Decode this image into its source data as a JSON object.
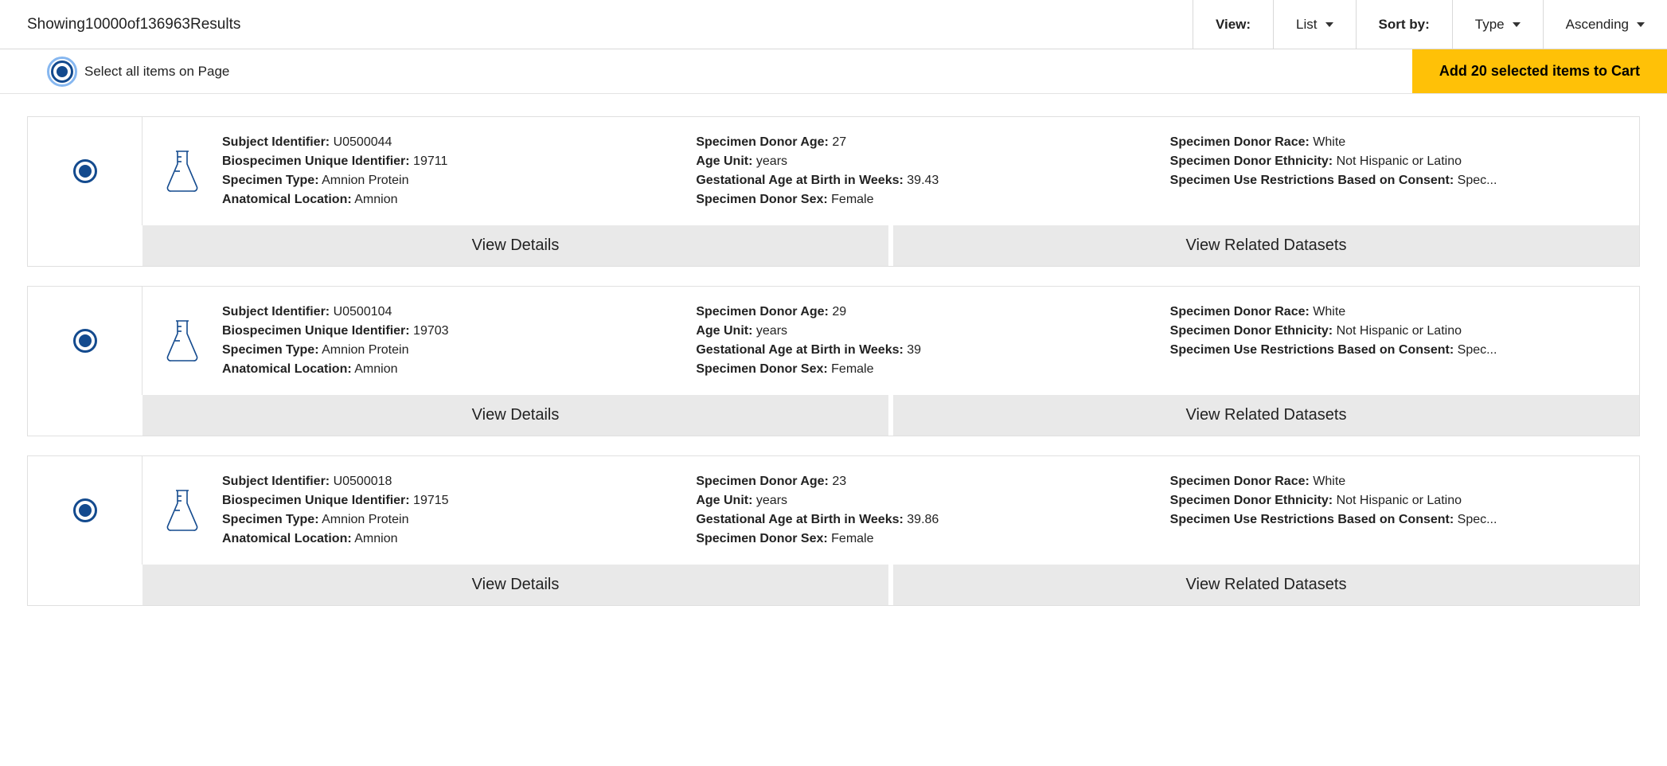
{
  "header": {
    "results_text_prefix": "Showing ",
    "shown": "10000",
    "of_word": " of ",
    "total": "136963",
    "results_word": " Results",
    "view_label": "View:",
    "view_value": "List",
    "sort_label": "Sort by:",
    "sort_value": "Type",
    "order_value": "Ascending"
  },
  "select_all_label": "Select all items on Page",
  "cart_button": "Add 20 selected items to Cart",
  "labels": {
    "subject_id": "Subject Identifier:",
    "biospecimen_id": "Biospecimen Unique Identifier:",
    "specimen_type": "Specimen Type:",
    "anatomical_location": "Anatomical Location:",
    "donor_age": "Specimen Donor Age:",
    "age_unit": "Age Unit:",
    "gestational_age": "Gestational Age at Birth in Weeks:",
    "donor_sex": "Specimen Donor Sex:",
    "donor_race": "Specimen Donor Race:",
    "donor_ethnicity": "Specimen Donor Ethnicity:",
    "use_restrictions": "Specimen Use Restrictions Based on Consent:",
    "view_details": "View Details",
    "view_related": "View Related Datasets"
  },
  "items": [
    {
      "subject_id": "U0500044",
      "biospecimen_id": "19711",
      "specimen_type": "Amnion Protein",
      "anatomical_location": "Amnion",
      "donor_age": "27",
      "age_unit": "years",
      "gestational_age": "39.43",
      "donor_sex": "Female",
      "donor_race": "White",
      "donor_ethnicity": "Not Hispanic or Latino",
      "use_restrictions": "Spec..."
    },
    {
      "subject_id": "U0500104",
      "biospecimen_id": "19703",
      "specimen_type": "Amnion Protein",
      "anatomical_location": "Amnion",
      "donor_age": "29",
      "age_unit": "years",
      "gestational_age": "39",
      "donor_sex": "Female",
      "donor_race": "White",
      "donor_ethnicity": "Not Hispanic or Latino",
      "use_restrictions": "Spec..."
    },
    {
      "subject_id": "U0500018",
      "biospecimen_id": "19715",
      "specimen_type": "Amnion Protein",
      "anatomical_location": "Amnion",
      "donor_age": "23",
      "age_unit": "years",
      "gestational_age": "39.86",
      "donor_sex": "Female",
      "donor_race": "White",
      "donor_ethnicity": "Not Hispanic or Latino",
      "use_restrictions": "Spec..."
    }
  ]
}
